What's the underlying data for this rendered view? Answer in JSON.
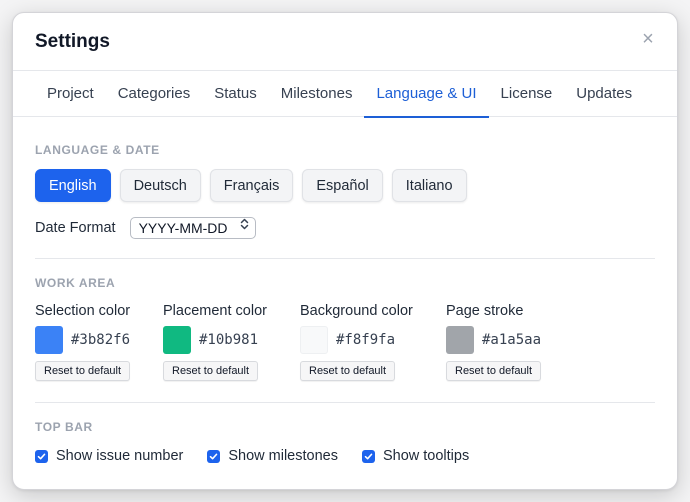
{
  "dialog": {
    "title": "Settings",
    "close_glyph": "×"
  },
  "tabs": [
    {
      "label": "Project"
    },
    {
      "label": "Categories"
    },
    {
      "label": "Status"
    },
    {
      "label": "Milestones"
    },
    {
      "label": "Language & UI",
      "active": true
    },
    {
      "label": "License"
    },
    {
      "label": "Updates"
    }
  ],
  "language_section": {
    "label": "Language & Date",
    "languages": [
      "English",
      "Deutsch",
      "Français",
      "Español",
      "Italiano"
    ],
    "selected_language": "English",
    "date_format_label": "Date Format",
    "date_format_value": "YYYY-MM-DD",
    "select_icon": "chevron-updown-icon"
  },
  "work_area": {
    "label": "Work Area",
    "reset_label": "Reset to default",
    "colors": [
      {
        "name": "Selection color",
        "hex": "#3b82f6"
      },
      {
        "name": "Placement color",
        "hex": "#10b981"
      },
      {
        "name": "Background color",
        "hex": "#f8f9fa"
      },
      {
        "name": "Page stroke",
        "hex": "#a1a5aa"
      }
    ]
  },
  "top_bar": {
    "label": "Top Bar",
    "options": [
      {
        "label": "Show issue number",
        "checked": true
      },
      {
        "label": "Show milestones",
        "checked": true
      },
      {
        "label": "Show tooltips",
        "checked": true
      }
    ],
    "check_icon": "checkmark-icon"
  },
  "theme": {
    "accent": "#1d63ed",
    "tab_active": "#1d5fd6"
  }
}
